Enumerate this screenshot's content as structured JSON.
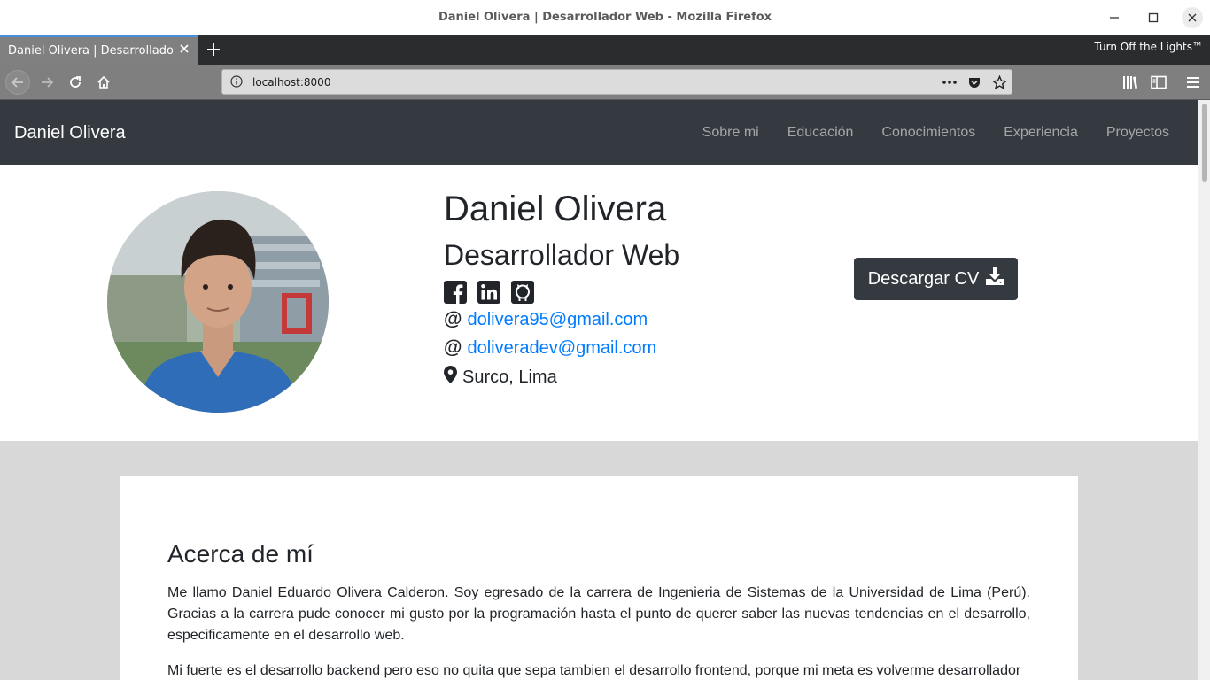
{
  "window": {
    "title": "Daniel Olivera | Desarrollador Web - Mozilla Firefox"
  },
  "browser": {
    "tab_title": "Daniel Olivera | Desarrollador Web",
    "extension_label": "Turn Off the Lights™",
    "url": "localhost:8000"
  },
  "site": {
    "brand": "Daniel Olivera",
    "nav": [
      "Sobre mi",
      "Educación",
      "Conocimientos",
      "Experiencia",
      "Proyectos"
    ]
  },
  "profile": {
    "name": "Daniel Olivera",
    "role": "Desarrollador Web",
    "email_1": "dolivera95@gmail.com",
    "email_2": "doliveradev@gmail.com",
    "location": "Surco, Lima",
    "cv_button": "Descargar CV",
    "social_icons": [
      "facebook-icon",
      "linkedin-icon",
      "github-icon"
    ]
  },
  "about": {
    "heading": "Acerca de mí",
    "paragraph_1": "Me llamo Daniel Eduardo Olivera Calderon. Soy egresado de la carrera de Ingenieria de Sistemas de la Universidad de Lima (Perú). Gracias a la carrera pude conocer mi gusto por la programación hasta el punto de querer saber las nuevas tendencias en el desarrollo, especificamente en el desarrollo web.",
    "paragraph_2": "Mi fuerte es el desarrollo backend pero eso no quita que sepa tambien el desarrollo frontend, porque mi meta es volverme desarrollador"
  },
  "colors": {
    "navbar_bg": "#343a40",
    "link": "#007bff",
    "section_bg": "#d8d8d8"
  }
}
